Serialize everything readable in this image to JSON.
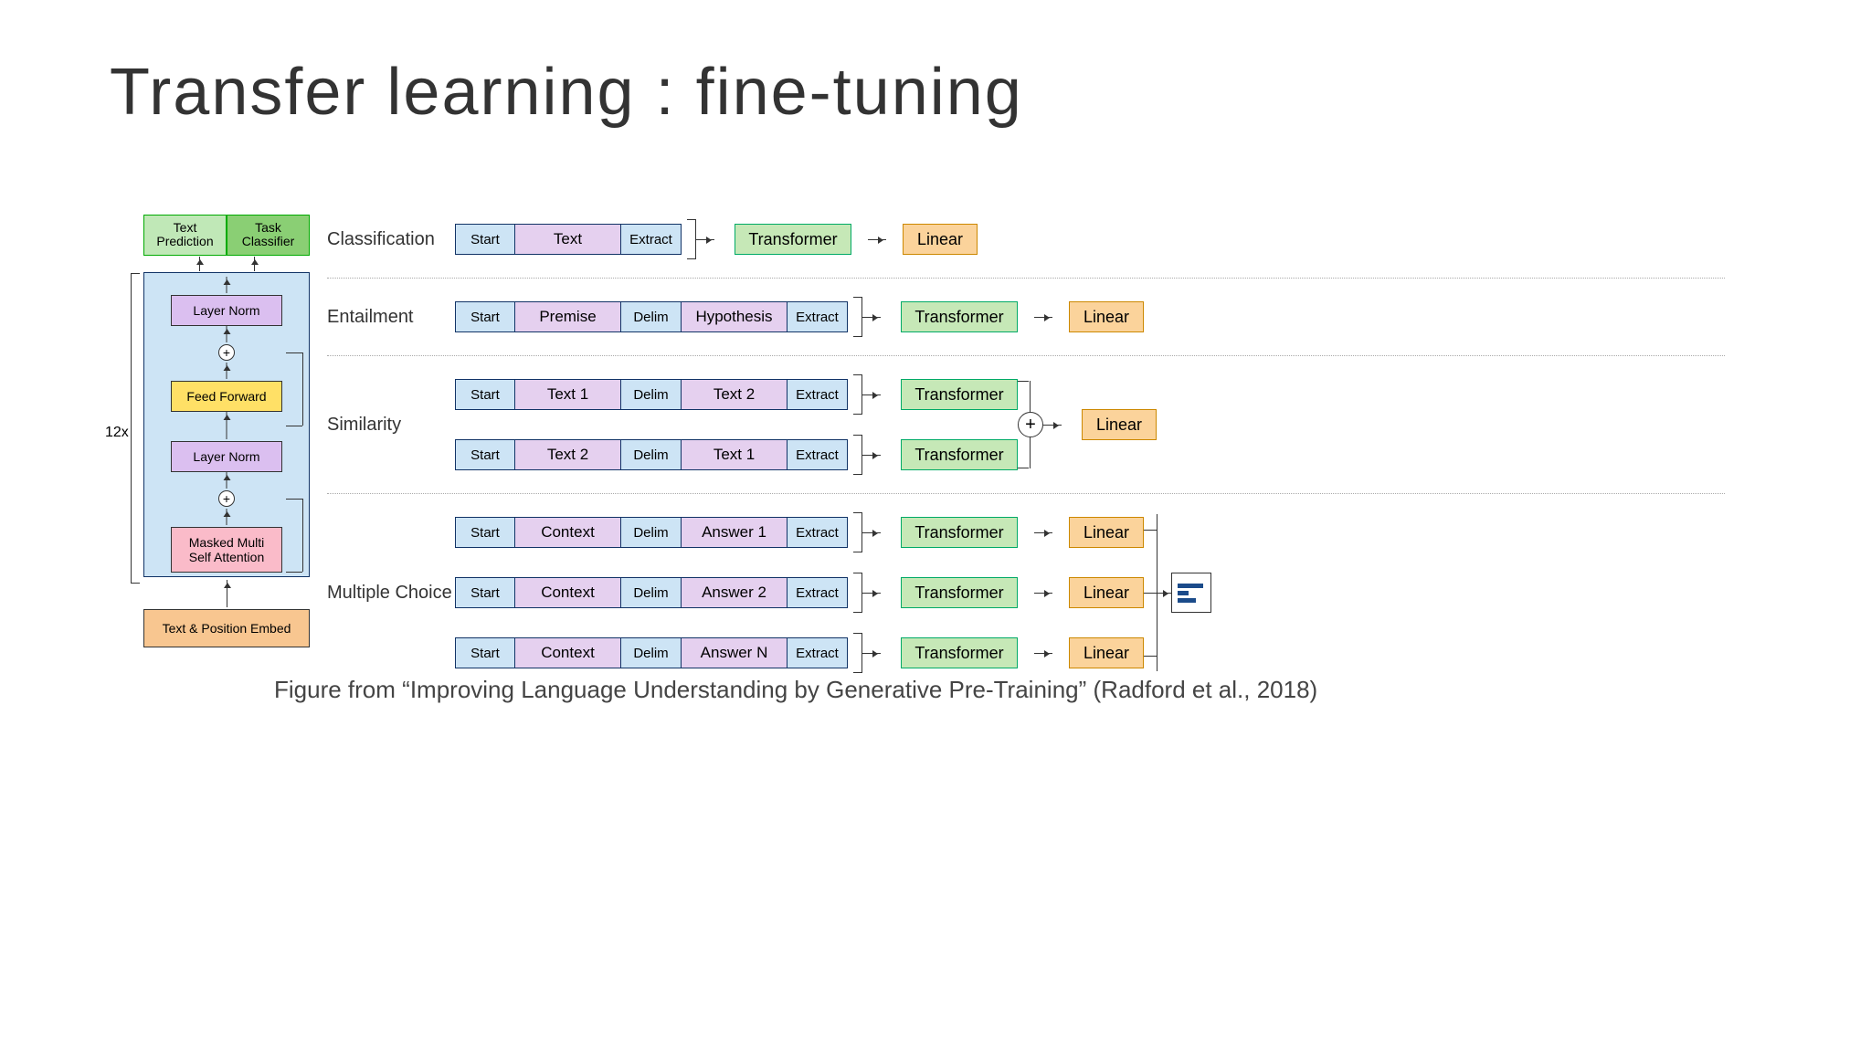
{
  "slide": {
    "title": "Transfer learning : fine-tuning",
    "caption_prefix": "Figure from ",
    "caption_quote": "“Improving Language Understanding by Generative Pre-Training”",
    "caption_suffix": " (Radford et al., 2018)"
  },
  "arch": {
    "head_left": "Text\nPrediction",
    "head_right": "Task\nClassifier",
    "layer_norm": "Layer Norm",
    "feed_forward": "Feed Forward",
    "mmsa": "Masked Multi\nSelf Attention",
    "embed": "Text & Position Embed",
    "repeat": "12x"
  },
  "labels": {
    "start": "Start",
    "extract": "Extract",
    "delim": "Delim",
    "transformer": "Transformer",
    "linear": "Linear"
  },
  "tasks": {
    "classification": {
      "label": "Classification",
      "tokens": [
        "Start",
        "Text",
        "Extract"
      ]
    },
    "entailment": {
      "label": "Entailment",
      "tokens": [
        "Start",
        "Premise",
        "Delim",
        "Hypothesis",
        "Extract"
      ]
    },
    "similarity": {
      "label": "Similarity",
      "row1": [
        "Start",
        "Text 1",
        "Delim",
        "Text 2",
        "Extract"
      ],
      "row2": [
        "Start",
        "Text 2",
        "Delim",
        "Text 1",
        "Extract"
      ]
    },
    "multiple_choice": {
      "label": "Multiple Choice",
      "rows": [
        [
          "Start",
          "Context",
          "Delim",
          "Answer 1",
          "Extract"
        ],
        [
          "Start",
          "Context",
          "Delim",
          "Answer 2",
          "Extract"
        ],
        [
          "Start",
          "Context",
          "Delim",
          "Answer N",
          "Extract"
        ]
      ]
    }
  }
}
